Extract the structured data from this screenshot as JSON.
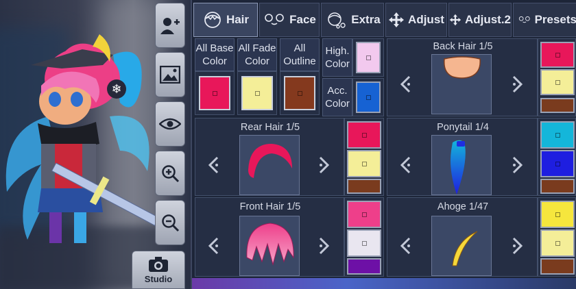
{
  "tool_column": {
    "studio_label": "Studio"
  },
  "tabs": [
    {
      "label": "Hair",
      "icon": "hair-icon"
    },
    {
      "label": "Face",
      "icon": "face-icon"
    },
    {
      "label": "Extra",
      "icon": "extra-icon"
    },
    {
      "label": "Adjust",
      "icon": "move-arrows-icon"
    },
    {
      "label": "Adjust.2",
      "icon": "move-arrows-icon"
    },
    {
      "label": "Presets",
      "icon": "face-icon"
    }
  ],
  "global_colors": {
    "all_base_color_label": "All Base Color",
    "all_fade_color_label": "All Fade Color",
    "all_outline_label": "All Outline",
    "high_color_label": "High. Color",
    "acc_color_label": "Acc. Color",
    "all_base_color": "#e8175a",
    "all_fade_color": "#f4ee98",
    "all_outline": "#84391e",
    "high_color": "#f2c9ee",
    "acc_color": "#1662d3"
  },
  "parts": {
    "back_hair": {
      "title": "Back Hair 1/5",
      "colors": [
        "#e8175a",
        "#f4ee98",
        "#7a3b1e"
      ]
    },
    "rear_hair": {
      "title": "Rear Hair 1/5",
      "colors": [
        "#e8175a",
        "#f4ee98",
        "#7a3b1e"
      ]
    },
    "ponytail": {
      "title": "Ponytail 1/4",
      "colors": [
        "#14b6da",
        "#1e1ee0",
        "#7a3b1e"
      ]
    },
    "front_hair": {
      "title": "Front Hair 1/5",
      "colors": [
        "#ee3f8a",
        "#e9e6f0",
        "#6d10a6"
      ]
    },
    "ahoge": {
      "title": "Ahoge 1/47",
      "colors": [
        "#f6e63d",
        "#f4ee98",
        "#7a3b1e"
      ]
    }
  }
}
